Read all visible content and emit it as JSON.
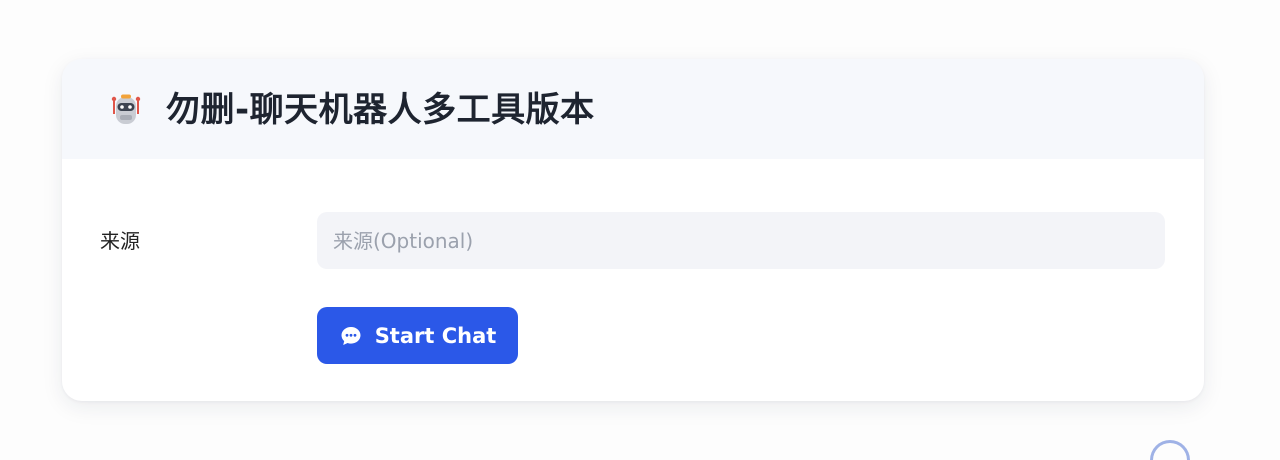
{
  "app": {
    "title": "勿删-聊天机器人多工具版本",
    "header_icon": "robot-icon"
  },
  "form": {
    "source_label": "来源",
    "source_placeholder": "来源(Optional)",
    "source_value": ""
  },
  "actions": {
    "start_chat_label": "Start Chat",
    "start_chat_icon": "chat-bubble-icon"
  },
  "colors": {
    "accent": "#2b58e8",
    "header_bg": "#f6f8fc",
    "input_bg": "#f3f4f8"
  }
}
